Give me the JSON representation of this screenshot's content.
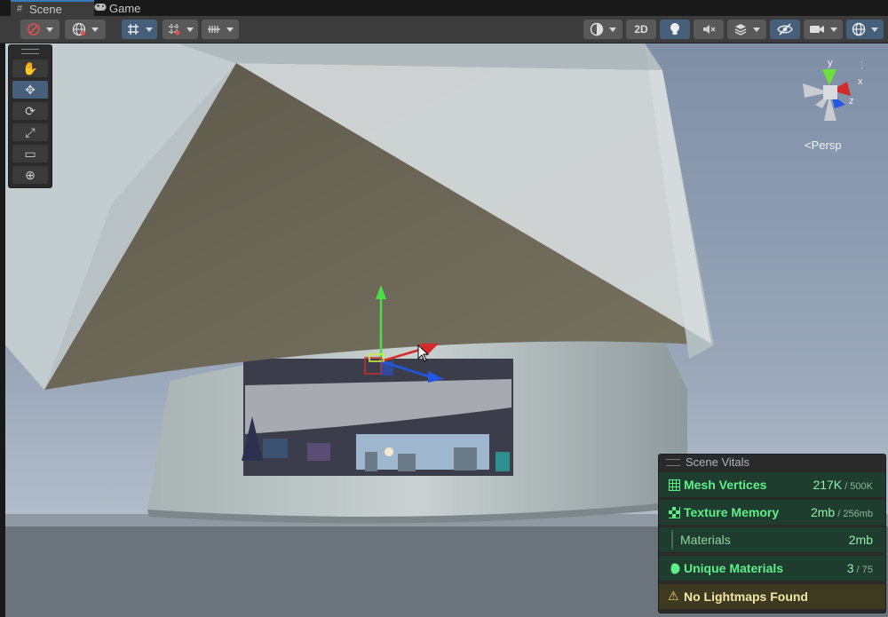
{
  "tabs": [
    {
      "label": "Scene",
      "icon": "grid-icon",
      "active": true
    },
    {
      "label": "Game",
      "icon": "gamepad-icon",
      "active": false
    }
  ],
  "toolbar": {
    "toggle_2d_label": "2D"
  },
  "tools": [
    "hand-tool-icon",
    "move-tool-icon",
    "rotate-tool-icon",
    "scale-tool-icon",
    "rect-tool-icon",
    "transform-tool-icon"
  ],
  "gizmo": {
    "axis_x": "x",
    "axis_y": "y",
    "axis_z": "z",
    "projection_label": "Persp"
  },
  "vitals": {
    "title": "Scene Vitals",
    "rows": [
      {
        "label": "Mesh Vertices",
        "value": "217K",
        "limit": " / 500K"
      },
      {
        "label": "Texture Memory",
        "value": "2mb",
        "limit": " / 256mb"
      },
      {
        "label": "Materials",
        "value": "2mb"
      },
      {
        "label": "Unique Materials",
        "value": "3",
        "limit": " / 75"
      },
      {
        "label": "No Lightmaps Found"
      }
    ]
  },
  "colors": {
    "accent": "#3a79bb",
    "vitals_green": "#5ef088",
    "vitals_bg": "#1f3d2f",
    "warning": "#f2d35b",
    "axis_x": "#d42a2a",
    "axis_y": "#4be04b",
    "axis_z": "#2456e6"
  }
}
